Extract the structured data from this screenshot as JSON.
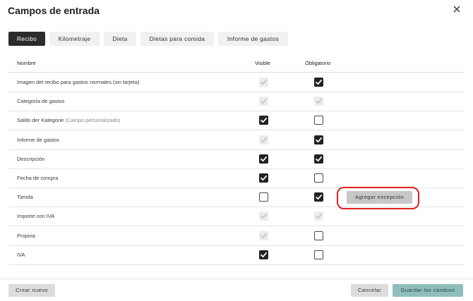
{
  "dialog": {
    "title": "Campos de entrada"
  },
  "tabs": [
    {
      "label": "Recibo",
      "active": true
    },
    {
      "label": "Kilometraje",
      "active": false
    },
    {
      "label": "Dieta",
      "active": false
    },
    {
      "label": "Dietas para comida",
      "active": false
    },
    {
      "label": "Informe de gastos",
      "active": false
    }
  ],
  "table": {
    "headers": {
      "name": "Nombre",
      "visible": "Visible",
      "required": "Obligatorio"
    },
    "rows": [
      {
        "name": "Imagen del recibo para gastos normales (sin tarjeta)",
        "hint": "",
        "visible": "disabled-checked",
        "required": "checked"
      },
      {
        "name": "Categoría de gastos",
        "hint": "",
        "visible": "disabled-checked",
        "required": "disabled-checked"
      },
      {
        "name": "Saldo der Kategorie",
        "hint": "(Campo personalizado)",
        "visible": "checked",
        "required": "unchecked"
      },
      {
        "name": "Informe de gastos",
        "hint": "",
        "visible": "disabled-checked",
        "required": "checked"
      },
      {
        "name": "Descripción",
        "hint": "",
        "visible": "checked",
        "required": "checked"
      },
      {
        "name": "Fecha de compra",
        "hint": "",
        "visible": "checked",
        "required": "unchecked"
      },
      {
        "name": "Tienda",
        "hint": "",
        "visible": "unchecked",
        "required": "checked",
        "action": "Agregar excepción"
      },
      {
        "name": "Importe con IVA",
        "hint": "",
        "visible": "disabled-checked",
        "required": "disabled-checked"
      },
      {
        "name": "Propina",
        "hint": "",
        "visible": "disabled-checked",
        "required": "unchecked"
      },
      {
        "name": "IVA",
        "hint": "",
        "visible": "checked",
        "required": "unchecked"
      }
    ]
  },
  "footer": {
    "new_label": "Crear nuevo",
    "cancel_label": "Cancelar",
    "save_label": "Guardar los cambios"
  },
  "colors": {
    "checked": "#222222",
    "disabled": "#ececec",
    "save_button": "#8fbfbd",
    "highlight": "#e02020"
  }
}
